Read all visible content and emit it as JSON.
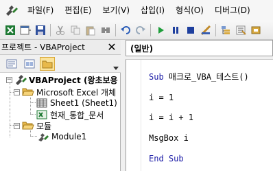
{
  "menubar": {
    "app_icon": "vba-editor-icon",
    "items": [
      {
        "label": "파일(F)"
      },
      {
        "label": "편집(E)"
      },
      {
        "label": "보기(V)"
      },
      {
        "label": "삽입(I)"
      },
      {
        "label": "형식(O)"
      },
      {
        "label": "디버그(D)"
      }
    ]
  },
  "toolbar": {
    "icons": [
      "excel-view-icon",
      "insert-module-icon",
      "save-icon",
      "cut-icon",
      "copy-icon",
      "paste-icon",
      "find-icon",
      "undo-icon",
      "redo-icon",
      "run-icon",
      "break-icon",
      "reset-icon",
      "design-mode-icon",
      "project-explorer-icon",
      "properties-icon",
      "object-browser-icon"
    ]
  },
  "project_panel": {
    "title": "프로젝트 - VBAProject",
    "close_label": "✕",
    "tree": {
      "project": "VBAProject (왕초보용",
      "objects_folder": "Microsoft Excel 개체",
      "sheet1": "Sheet1 (Sheet1)",
      "workbook": "현재_통합_문서",
      "modules_folder": "모듈",
      "module1": "Module1"
    }
  },
  "code_pane": {
    "object_combo": "(일반)",
    "lines": [
      {
        "kw": "Sub",
        "rest": " 매크로_VBA_테스트()"
      },
      {
        "kw": "",
        "rest": "i = 1"
      },
      {
        "kw": "",
        "rest": "i = i + 1"
      },
      {
        "kw": "",
        "rest": "MsgBox i"
      },
      {
        "kw": "End Sub",
        "rest": ""
      }
    ]
  },
  "colors": {
    "keyword": "#1a1aa6",
    "active_tool": "#fbe39a"
  }
}
